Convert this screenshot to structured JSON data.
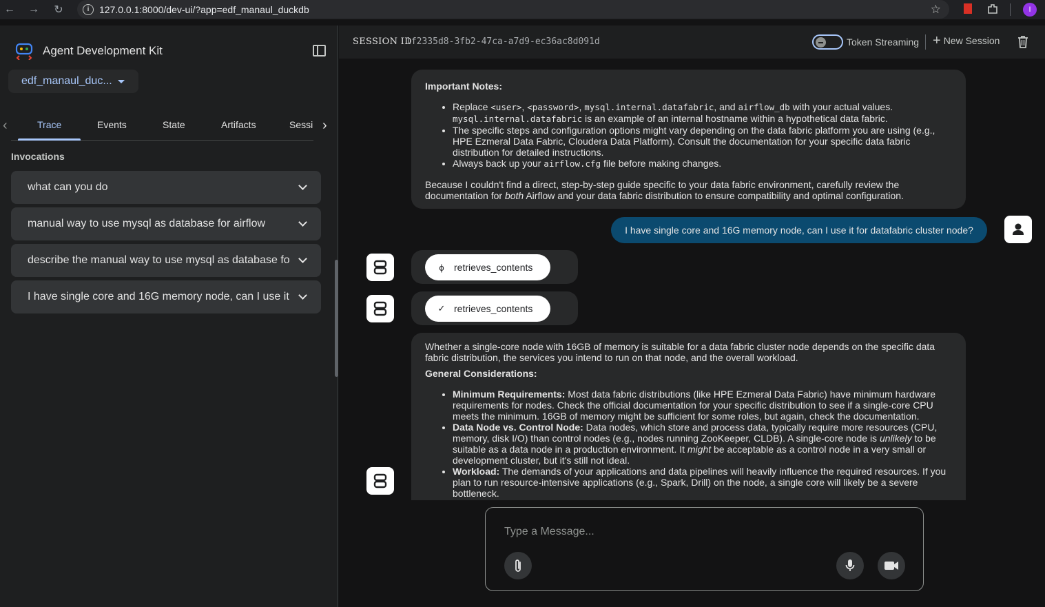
{
  "browser": {
    "url": "127.0.0.1:8000/dev-ui/?app=edf_manaul_duckdb",
    "profile_initial": "I"
  },
  "sidebar": {
    "title": "Agent Development Kit",
    "app_selector": "edf_manaul_duc...",
    "tabs": [
      "Trace",
      "Events",
      "State",
      "Artifacts",
      "Sessi"
    ],
    "active_tab": "Trace",
    "section_label": "Invocations",
    "invocations": [
      "what can you do",
      "manual way to use mysql as database for airflow",
      "describe the manual way to use mysql as database fo",
      "I have single core and 16G memory node, can I use it"
    ]
  },
  "header": {
    "session_label": "SESSION ID",
    "session_id": "1f2335d8-3fb2-47ca-a7d9-ec36ac8d091d",
    "token_streaming_label": "Token Streaming",
    "new_session_label": "New Session"
  },
  "messages": {
    "notes_title": "Important Notes:",
    "note1_a": "Replace ",
    "note1_code1": "<user>",
    "note1_b": ", ",
    "note1_code2": "<password>",
    "note1_c": ", ",
    "note1_code3": "mysql.internal.datafabric",
    "note1_d": ", and ",
    "note1_code4": "airflow_db",
    "note1_e": " with your actual values. ",
    "note1_code5": "mysql.internal.datafabric",
    "note1_f": " is an example of an internal hostname within a hypothetical data fabric.",
    "note2": "The specific steps and configuration options might vary depending on the data fabric platform you are using (e.g., HPE Ezmeral Data Fabric, Cloudera Data Platform). Consult the documentation for your specific data fabric distribution for detailed instructions.",
    "note3_a": "Always back up your ",
    "note3_code": "airflow.cfg",
    "note3_b": " file before making changes.",
    "closing_a": "Because I couldn't find a direct, step-by-step guide specific to your data fabric environment, carefully review the documentation for ",
    "closing_em": "both",
    "closing_b": " Airflow and your data fabric distribution to ensure compatibility and optimal configuration.",
    "user_message": "I have single core and 16G memory node, can I use it for datafabric cluster node?",
    "tool_call": "retrieves_contents",
    "tool_result": "retrieves_contents",
    "answer_intro": "Whether a single-core node with 16GB of memory is suitable for a data fabric cluster node depends on the specific data fabric distribution, the services you intend to run on that node, and the overall workload.",
    "answer_heading": "General Considerations:",
    "b1_title": "Minimum Requirements:",
    "b1_text": " Most data fabric distributions (like HPE Ezmeral Data Fabric) have minimum hardware requirements for nodes. Check the official documentation for your specific distribution to see if a single-core CPU meets the minimum. 16GB of memory might be sufficient for some roles, but again, check the documentation.",
    "b2_title": "Data Node vs. Control Node:",
    "b2_text_a": " Data nodes, which store and process data, typically require more resources (CPU, memory, disk I/O) than control nodes (e.g., nodes running ZooKeeper, CLDB). A single-core node is ",
    "b2_em1": "unlikely",
    "b2_text_b": " to be suitable as a data node in a production environment. It ",
    "b2_em2": "might",
    "b2_text_c": " be acceptable as a control node in a very small or development cluster, but it's still not ideal.",
    "b3_title": "Workload:",
    "b3_text": " The demands of your applications and data pipelines will heavily influence the required resources. If you plan to run resource-intensive applications (e.g., Spark, Drill) on the node, a single core will likely be a severe bottleneck."
  },
  "composer": {
    "placeholder": "Type a Message..."
  },
  "colors": {
    "accent": "#a8c7fa",
    "user_bubble": "#0b4a6f",
    "bot_bubble": "#28292a"
  }
}
